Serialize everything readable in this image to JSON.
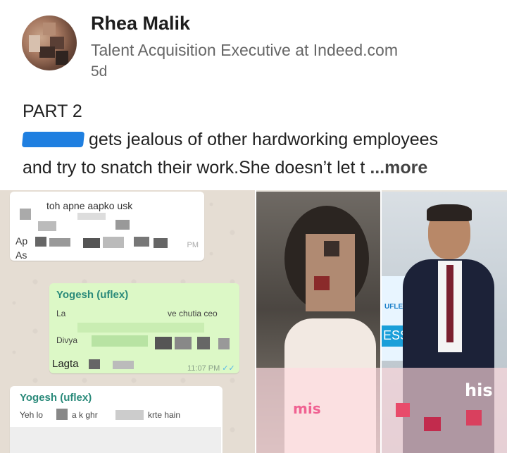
{
  "author": {
    "name": "Rhea Malik",
    "headline": "Talent Acquisition Executive at Indeed.com",
    "time": "5d",
    "avatar_icon": "profile-avatar-blurred"
  },
  "post": {
    "title": "PART 2",
    "line1_text": "gets jealous of other hardworking employees",
    "line2_text": "and try to snatch their work.She doesn’t let t",
    "more_label": "...more"
  },
  "chat": {
    "bubble1": {
      "line1": "toh apne aapko usk",
      "line2": "Ap",
      "line3": "As",
      "time": "PM"
    },
    "bubble2": {
      "sender": "Yogesh (uflex)",
      "line1": "La",
      "line1_right": "ve chutia ceo",
      "line2": "Divya",
      "line3": "Lagta",
      "time": "11:07 PM",
      "ticks": "✓✓"
    },
    "bubble3": {
      "sender": "Yogesh (uflex)",
      "line1_left": "Yeh lo",
      "line1_mid": "a k ghr",
      "line1_right": "krte hain"
    }
  },
  "photos": {
    "woman_icon": "blurred-woman-photo",
    "man_icon": "man-in-suit-photo",
    "sign_uflex": "UFLEX",
    "sign_ess": "ESS",
    "overlay_his": "his",
    "overlay_mis": "mis"
  },
  "colors": {
    "redaction": "#1f7fe0",
    "chat_green": "#dcf8c6",
    "chat_sender": "#2a8a7a",
    "chat_bg": "#e5ddd3"
  }
}
